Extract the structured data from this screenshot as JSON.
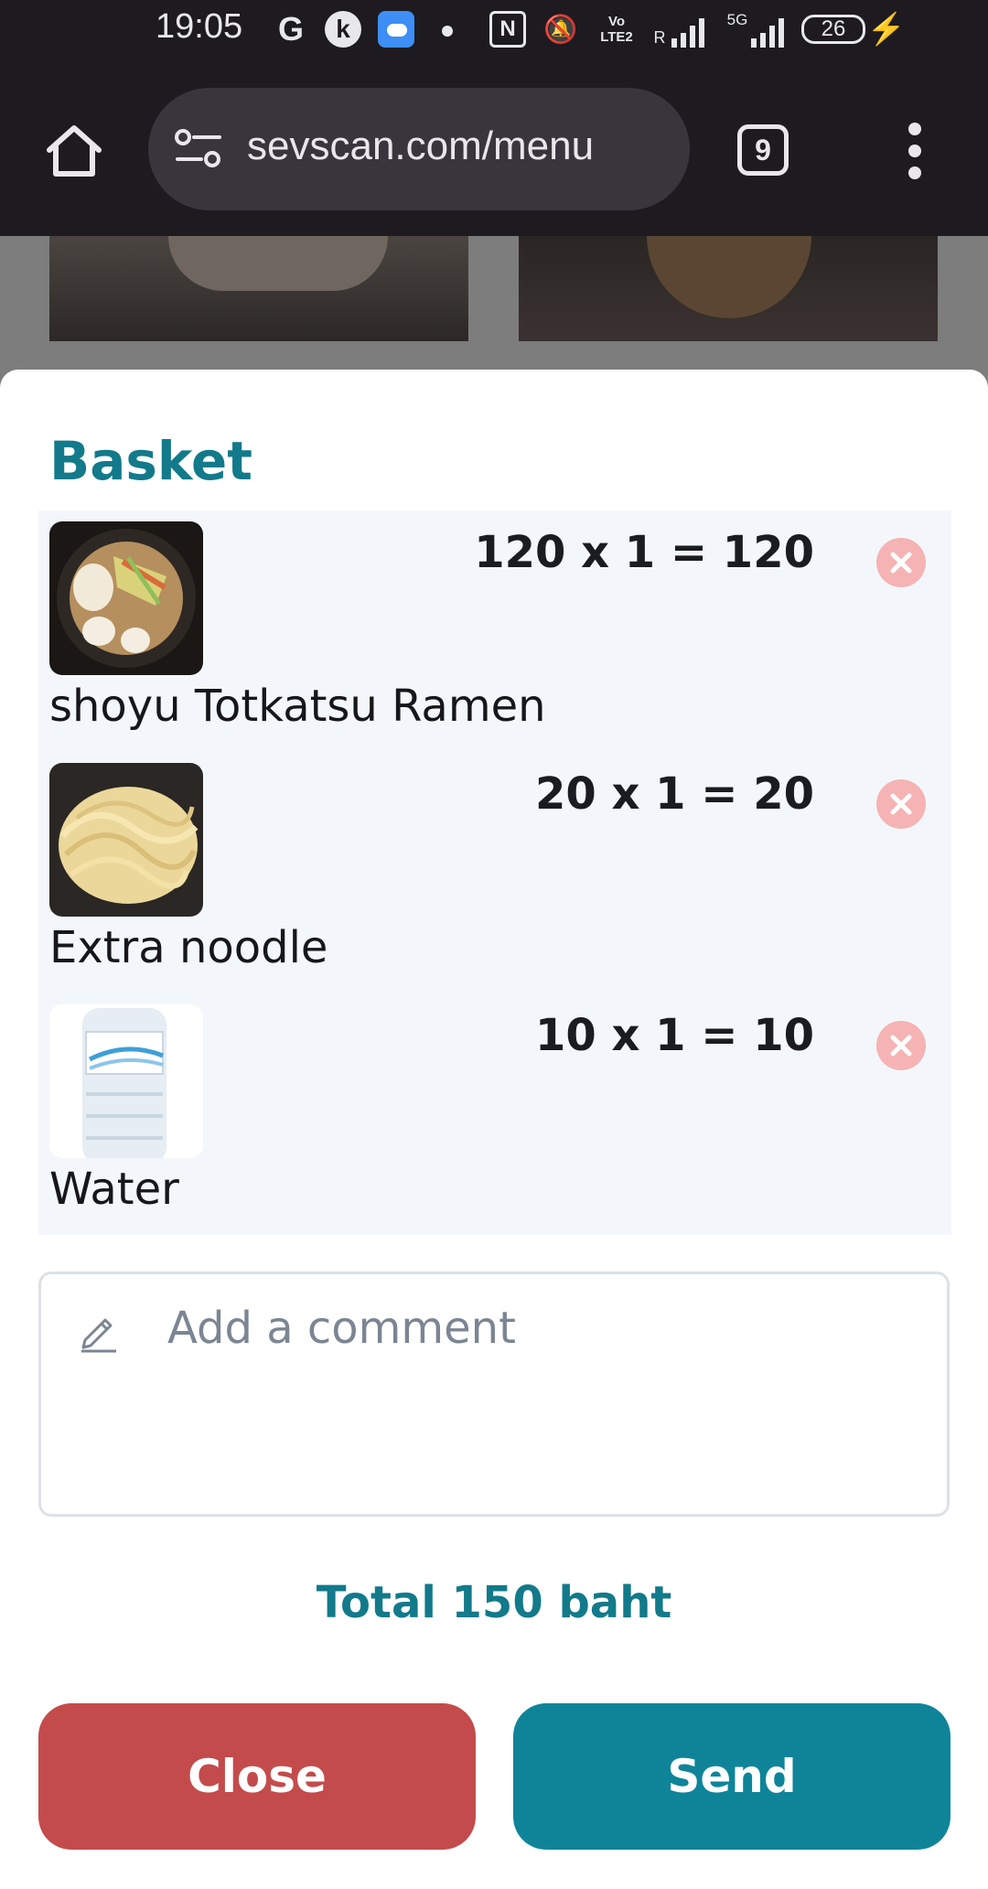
{
  "status_bar": {
    "time": "19:05",
    "g_label": "G",
    "k_label": "k",
    "nfc_label": "N",
    "vo_label_1": "Vo",
    "vo_label_2": "LTE2",
    "roaming_label": "R",
    "net_label": "5G",
    "battery": "26"
  },
  "browser": {
    "url": "sevscan.com/menu",
    "tab_count": "9"
  },
  "basket": {
    "title": "Basket",
    "items": [
      {
        "name": "shoyu Totkatsu Ramen",
        "calc": "120 x 1 = 120",
        "thumb": "ramen-bowl"
      },
      {
        "name": "Extra noodle",
        "calc": "20 x 1 = 20",
        "thumb": "noodles"
      },
      {
        "name": "Water",
        "calc": "10 x 1 = 10",
        "thumb": "water-bottle"
      }
    ],
    "comment_placeholder": "Add a comment",
    "total": "Total 150 baht",
    "close_label": "Close",
    "send_label": "Send"
  },
  "colors": {
    "accent": "#127a8a",
    "close": "#c44b4b",
    "send": "#0f8499",
    "remove": "#f6b3b3"
  }
}
